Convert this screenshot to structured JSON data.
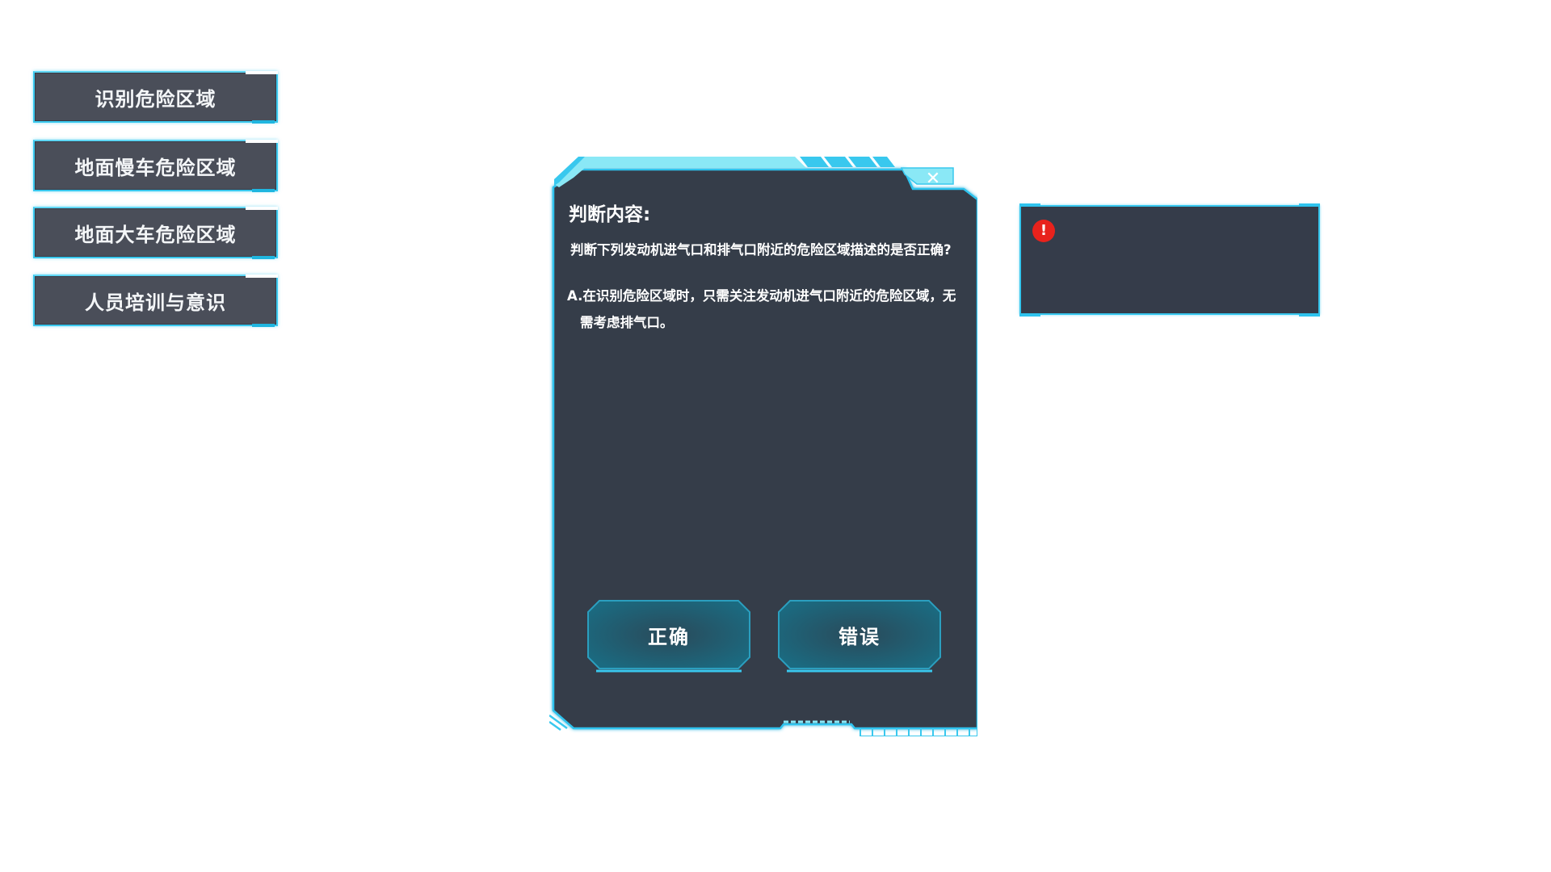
{
  "sidebar": {
    "items": [
      {
        "label": "识别危险区域"
      },
      {
        "label": "地面慢车危险区域"
      },
      {
        "label": "地面大车危险区域"
      },
      {
        "label": "人员培训与意识"
      }
    ]
  },
  "dialog": {
    "title": "判断内容:",
    "question": "判断下列发动机进气口和排气口附近的危险区域描述的是否正确?",
    "option_line1": "A.在识别危险区域时，只需关注发动机进气口附近的危险区域，无",
    "option_line2": "需考虑排气口。",
    "close_icon": "close-icon",
    "buttons": {
      "correct": "正确",
      "wrong": "错误"
    }
  },
  "feedback": {
    "icon": "warning-icon",
    "icon_glyph": "!",
    "message": ""
  },
  "colors": {
    "accent": "#36c6ee",
    "panel": "#353c4a",
    "menu": "#4a4e59",
    "warning": "#e8221c"
  }
}
